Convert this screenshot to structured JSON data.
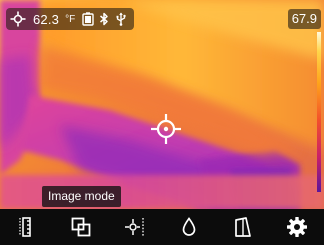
{
  "status_bar": {
    "spot_temperature": "62.3",
    "unit": "°F",
    "max_temperature": "67.9",
    "icons": [
      "spot-measurement-icon",
      "battery-icon",
      "bluetooth-icon",
      "usb-icon"
    ]
  },
  "tooltip": {
    "label": "Image mode"
  },
  "toolbar": {
    "buttons": [
      {
        "name": "palette-scale-icon"
      },
      {
        "name": "image-mode-icon"
      },
      {
        "name": "spot-measure-icon"
      },
      {
        "name": "palette-drop-icon"
      },
      {
        "name": "emissivity-icon"
      },
      {
        "name": "settings-gear-icon"
      }
    ]
  },
  "colors": {
    "palette_hot": "#ffd64a",
    "palette_warm": "#f3502b",
    "palette_cool": "#c91f6a",
    "palette_cold": "#5a159c",
    "toolbar_bg": "#0c0c0c",
    "icon_color": "#ffffff"
  }
}
